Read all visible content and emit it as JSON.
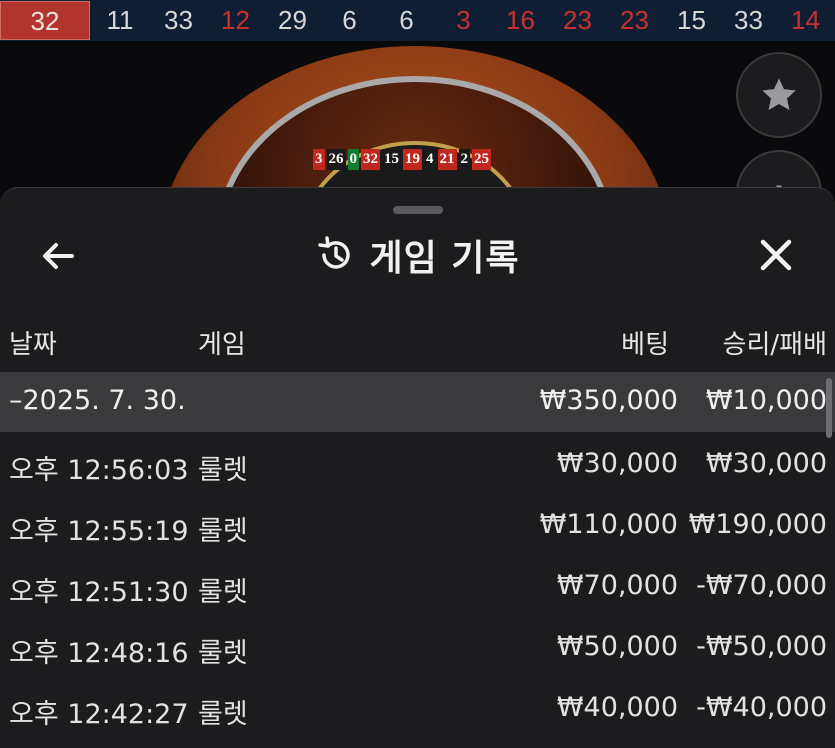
{
  "history": {
    "numbers": [
      {
        "value": "32",
        "color": "red"
      },
      {
        "value": "11",
        "color": "black"
      },
      {
        "value": "33",
        "color": "black"
      },
      {
        "value": "12",
        "color": "red"
      },
      {
        "value": "29",
        "color": "black"
      },
      {
        "value": "6",
        "color": "black"
      },
      {
        "value": "6",
        "color": "black"
      },
      {
        "value": "3",
        "color": "red"
      },
      {
        "value": "16",
        "color": "red"
      },
      {
        "value": "23",
        "color": "red"
      },
      {
        "value": "23",
        "color": "red"
      },
      {
        "value": "15",
        "color": "black"
      },
      {
        "value": "33",
        "color": "black"
      },
      {
        "value": "14",
        "color": "red"
      }
    ]
  },
  "wheel": {
    "numbers": [
      {
        "v": "3",
        "c": "r"
      },
      {
        "v": "26",
        "c": "b"
      },
      {
        "v": "0",
        "c": "g"
      },
      {
        "v": "32",
        "c": "r"
      },
      {
        "v": "15",
        "c": "b"
      },
      {
        "v": "19",
        "c": "r"
      },
      {
        "v": "4",
        "c": "b"
      },
      {
        "v": "21",
        "c": "r"
      },
      {
        "v": "2",
        "c": "b"
      },
      {
        "v": "25",
        "c": "r"
      }
    ]
  },
  "side_buttons": {
    "favorite_icon": "star-icon",
    "stats_icon": "stats-icon"
  },
  "sheet": {
    "title": "게임 기록",
    "back_icon": "back-arrow-icon",
    "history_icon": "history-icon",
    "close_icon": "close-icon",
    "columns": {
      "date": "날짜",
      "game": "게임",
      "bet": "베팅",
      "result": "승리/패배"
    },
    "date_group": {
      "label": "–2025. 7. 30.",
      "bet": "₩350,000",
      "result": "₩10,000"
    },
    "rows": [
      {
        "time": "오후 12:56:03",
        "game": "룰렛",
        "bet": "₩30,000",
        "result": "₩30,000"
      },
      {
        "time": "오후 12:55:19",
        "game": "룰렛",
        "bet": "₩110,000",
        "result": "₩190,000"
      },
      {
        "time": "오후 12:51:30",
        "game": "룰렛",
        "bet": "₩70,000",
        "result": "-₩70,000"
      },
      {
        "time": "오후 12:48:16",
        "game": "룰렛",
        "bet": "₩50,000",
        "result": "-₩50,000"
      },
      {
        "time": "오후 12:42:27",
        "game": "룰렛",
        "bet": "₩40,000",
        "result": "-₩40,000"
      }
    ]
  },
  "colors": {
    "red_number": "#c8322e",
    "strip_bg": "#0f1e33",
    "sheet_bg": "#1c1c1e",
    "date_row_bg": "#3a3a3c"
  }
}
